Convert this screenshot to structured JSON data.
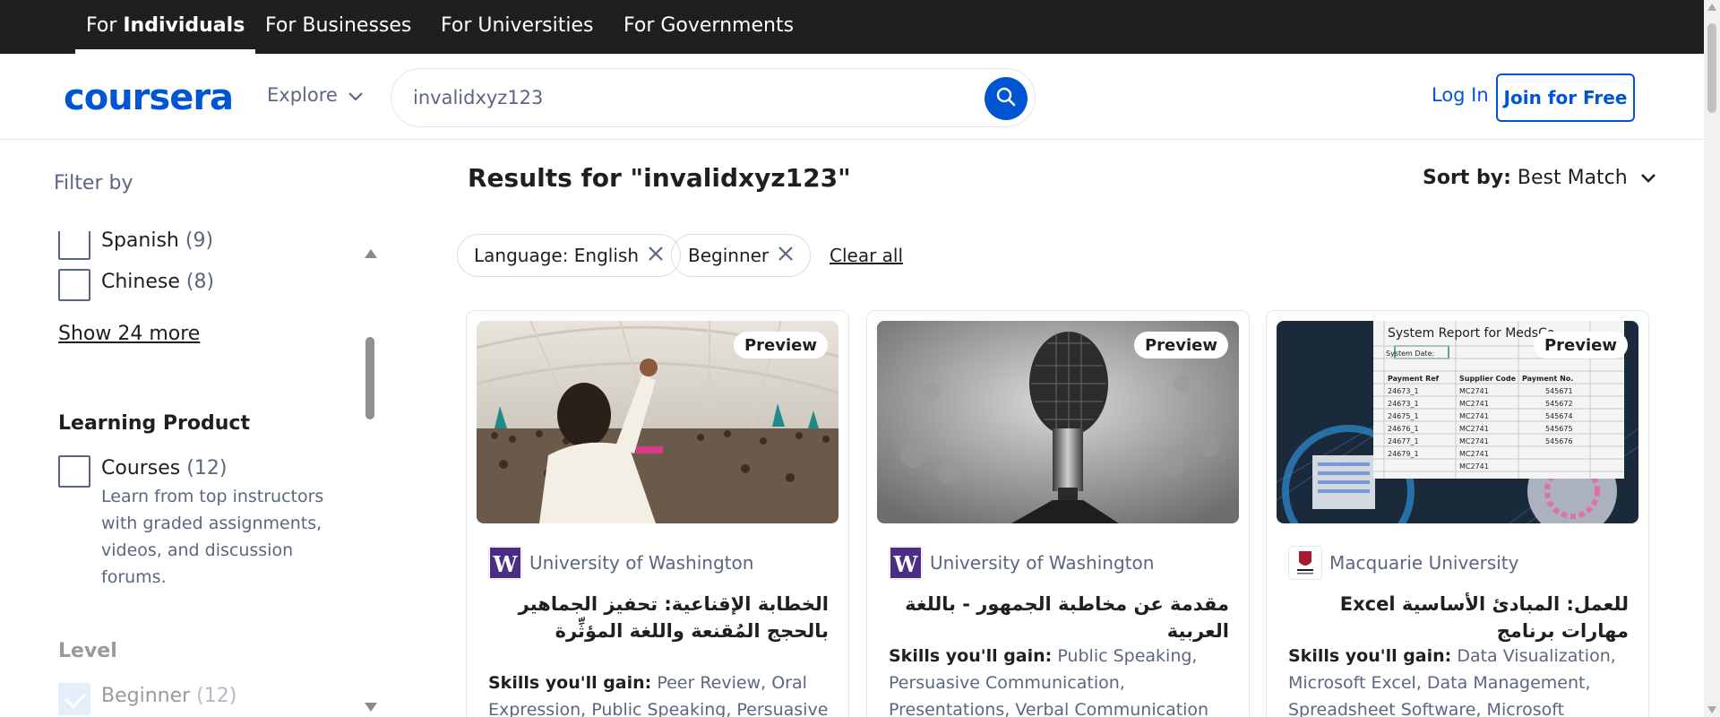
{
  "audience_tabs": [
    {
      "prefix": "For ",
      "bold": "Individuals"
    },
    {
      "label": "For Businesses"
    },
    {
      "label": "For Universities"
    },
    {
      "label": "For Governments"
    }
  ],
  "header": {
    "logo": "coursera",
    "explore": "Explore",
    "search_value": "invalidxyz123",
    "login": "Log In",
    "join": "Join for Free"
  },
  "sidebar": {
    "filter_by": "Filter by",
    "languages": [
      {
        "label": "Spanish",
        "count": "(9)"
      },
      {
        "label": "Chinese",
        "count": "(8)"
      }
    ],
    "show_more": "Show 24 more",
    "learning_product": {
      "title": "Learning Product",
      "items": [
        {
          "label": "Courses",
          "count": "(12)",
          "desc": "Learn from top instructors with graded assignments, videos, and discussion forums."
        }
      ]
    },
    "level": {
      "title": "Level",
      "items": [
        {
          "label": "Beginner",
          "count": "(12)",
          "checked": true
        }
      ]
    }
  },
  "main": {
    "results_title": "Results for \"invalidxyz123\"",
    "sort_label": "Sort by:",
    "sort_value": "Best Match",
    "chips": [
      {
        "label": "Language: English"
      },
      {
        "label": "Beginner"
      }
    ],
    "clear_all": "Clear all",
    "cards": [
      {
        "preview": "Preview",
        "partner": "University of Washington",
        "title": "الخطابة الإقناعية: تحفيز الجماهير بالحجج المُقنعة واللغة المؤثِّرة",
        "skills_label": "Skills you'll gain:",
        "skills": "Peer Review, Oral Expression, Public Speaking, Persuasive"
      },
      {
        "preview": "Preview",
        "partner": "University of Washington",
        "title": "مقدمة عن مخاطبة الجمهور - باللغة العربية",
        "skills_label": "Skills you'll gain:",
        "skills": "Public Speaking, Persuasive Communication, Presentations, Verbal Communication Skills,..."
      },
      {
        "preview": "Preview",
        "partner": "Macquarie University",
        "title": "للعمل: المبادئ الأساسية Excel مهارات برنامج",
        "skills_label": "Skills you'll gain:",
        "skills": "Data Visualization, Microsoft Excel, Data Management, Spreadsheet Software, Microsoft Office,..."
      }
    ],
    "excel_image": {
      "heading": "System Report for MedsCo",
      "system_date": "System Date:",
      "columns": [
        "Payment Ref",
        "Supplier Code",
        "Payment No."
      ],
      "rows": [
        [
          "24673_1",
          "MC2741",
          "545671"
        ],
        [
          "24673_1",
          "MC2741",
          "545672"
        ],
        [
          "24675_1",
          "MC2741",
          "545674"
        ],
        [
          "24676_1",
          "MC2741",
          "545675"
        ],
        [
          "24677_1",
          "MC2741",
          "545676"
        ],
        [
          "24679_1",
          "MC2741",
          ""
        ],
        [
          "",
          "MC2741",
          ""
        ]
      ]
    }
  },
  "colors": {
    "brand": "#0056d2",
    "dark": "#1f1f1f",
    "uw_purple": "#4b2e83",
    "mq_red": "#a6192e"
  }
}
